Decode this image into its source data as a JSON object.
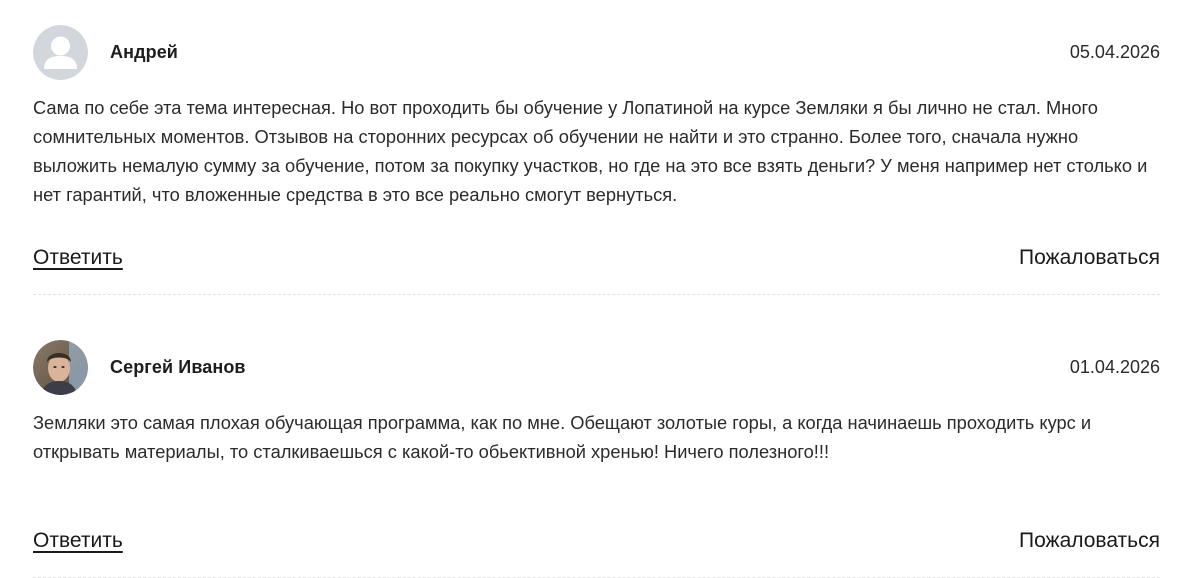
{
  "comments": [
    {
      "author": "Андрей",
      "date": "05.04.2026",
      "avatar_icon": "default-user-icon",
      "text": "Сама по себе эта тема интересная. Но вот проходить бы обучение у Лопатиной на курсе Земляки я бы лично не стал. Много сомнительных моментов. Отзывов на сторонних ресурсах об обучении не найти и это странно. Более того, сначала нужно выложить немалую сумму за обучение, потом за покупку участков, но где на это все взять деньги? У меня например нет столько и нет гарантий, что вложенные средства в это все реально смогут вернуться.",
      "reply_label": "Ответить",
      "complain_label": "Пожаловаться"
    },
    {
      "author": "Сергей Иванов",
      "date": "01.04.2026",
      "avatar_icon": "user-photo",
      "text": "Земляки это самая плохая обучающая программа, как по мне. Обещают золотые горы, а когда начинаешь проходить курс и открывать материалы, то сталкиваешься с какой-то обьективной хренью! Ничего полезного!!!",
      "reply_label": "Ответить",
      "complain_label": "Пожаловаться"
    }
  ],
  "colors": {
    "text": "#2b2b2b",
    "divider": "#e2e2e2",
    "avatar_placeholder_bg": "#d2d6dd",
    "avatar_placeholder_fg": "#ffffff"
  }
}
